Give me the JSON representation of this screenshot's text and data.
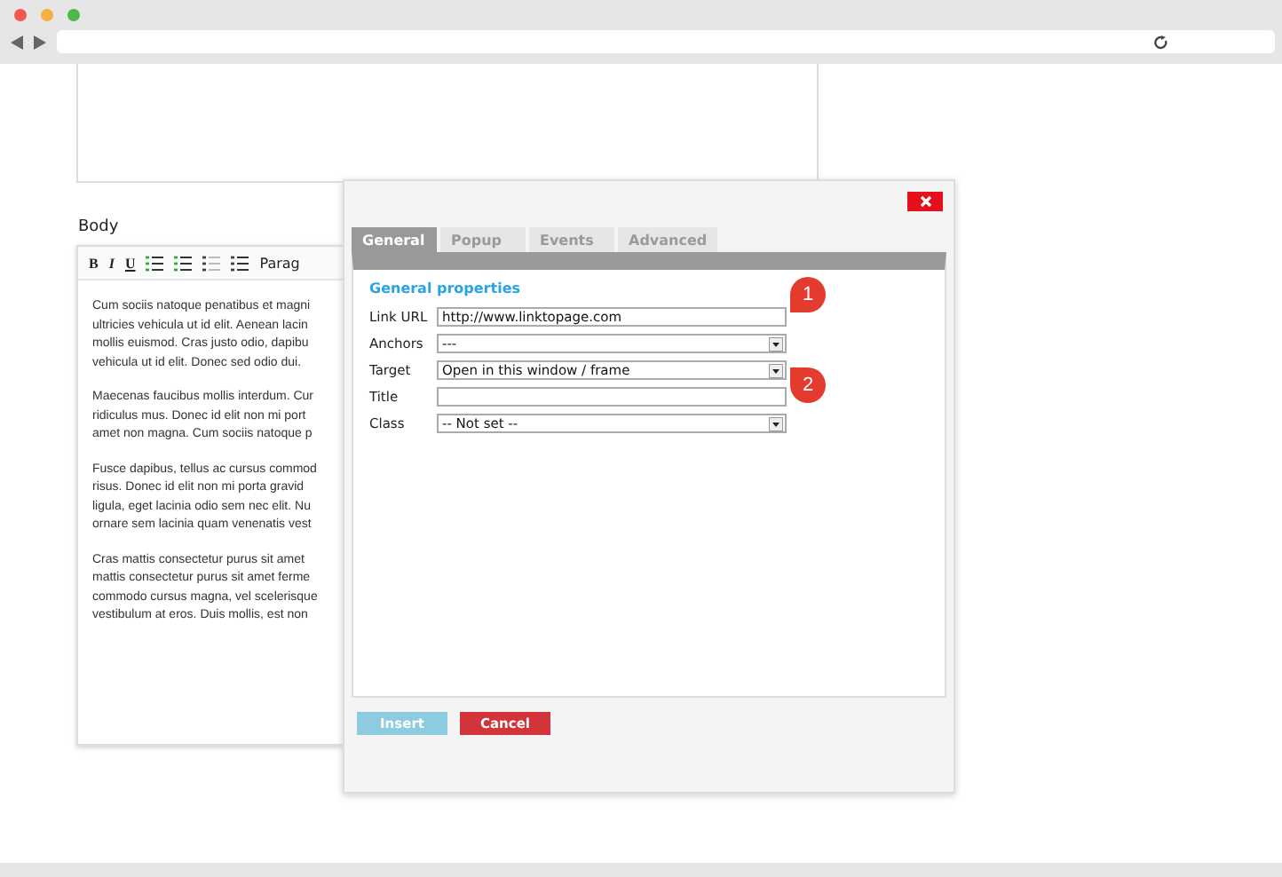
{
  "editor": {
    "label": "Body",
    "toolbar": [
      {
        "kind": "bold",
        "text": "B"
      },
      {
        "kind": "italic",
        "text": "I"
      },
      {
        "kind": "underline",
        "text": "U"
      },
      {
        "kind": "bullets"
      },
      {
        "kind": "numbers"
      },
      {
        "kind": "outdent"
      },
      {
        "kind": "indent"
      },
      {
        "kind": "format",
        "text": "Parag"
      }
    ],
    "paragraphs": [
      [
        "Cum sociis natoque penatibus et magni",
        "ultricies vehicula ut id elit. Aenean lacin",
        "mollis euismod. Cras justo odio, dapibu",
        "vehicula ut id elit. Donec sed odio dui."
      ],
      [
        "Maecenas faucibus mollis interdum. Cur",
        "ridiculus mus. Donec id elit non mi port",
        "amet non magna. Cum sociis natoque p"
      ],
      [
        "Fusce dapibus, tellus ac cursus commod",
        "risus. Donec id elit non mi porta gravid",
        "ligula, eget lacinia odio sem nec elit. Nu",
        "ornare sem lacinia quam venenatis vest"
      ],
      [
        "Cras mattis consectetur purus sit amet",
        "mattis consectetur purus sit amet ferme",
        "commodo cursus magna, vel scelerisque",
        "vestibulum at eros. Duis mollis, est non"
      ]
    ]
  },
  "dialog": {
    "tabs": [
      {
        "label": "General",
        "selected": true
      },
      {
        "label": "Popup",
        "selected": false
      },
      {
        "label": "Events",
        "selected": false
      },
      {
        "label": "Advanced",
        "selected": false
      }
    ],
    "section_title": "General properties",
    "fields": [
      {
        "label": "Link URL",
        "kind": "input",
        "value": "http://www.linktopage.com",
        "marker": "1"
      },
      {
        "label": "Anchors",
        "kind": "select",
        "value": "---"
      },
      {
        "label": "Target",
        "kind": "select",
        "value": "Open in this window / frame",
        "marker": "2"
      },
      {
        "label": "Title",
        "kind": "input"
      },
      {
        "label": "Class",
        "kind": "select",
        "value": "-- Not set --"
      }
    ],
    "buttons": [
      {
        "label": "Insert",
        "kind": "primary"
      },
      {
        "label": "Cancel",
        "kind": "danger"
      }
    ]
  }
}
